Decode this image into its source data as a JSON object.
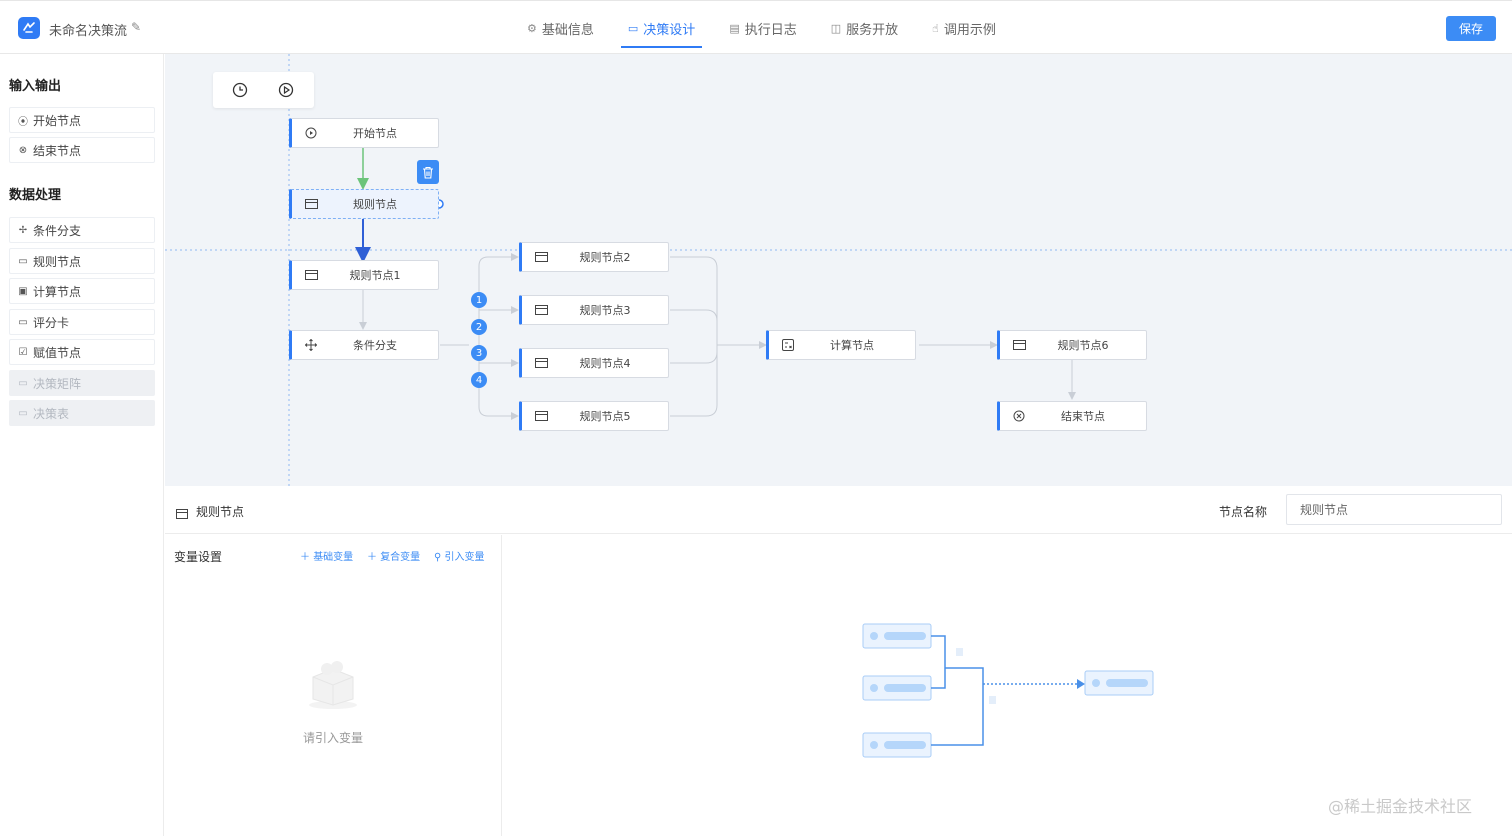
{
  "app": {
    "title": "未命名决策流"
  },
  "tabs": [
    {
      "label": "基础信息",
      "icon": "gear-icon",
      "active": false
    },
    {
      "label": "决策设计",
      "icon": "design-icon",
      "active": true
    },
    {
      "label": "执行日志",
      "icon": "document-icon",
      "active": false
    },
    {
      "label": "服务开放",
      "icon": "book-icon",
      "active": false
    },
    {
      "label": "调用示例",
      "icon": "thumb-icon",
      "active": false
    }
  ],
  "toolbar": {
    "save_label": "保存"
  },
  "sidebar": {
    "section1": "输入输出",
    "section2": "数据处理",
    "items": [
      {
        "label": "开始节点",
        "icon": "play-circle-icon",
        "disabled": false
      },
      {
        "label": "结束节点",
        "icon": "close-circle-icon",
        "disabled": false
      },
      {
        "label": "条件分支",
        "icon": "move-icon",
        "disabled": false
      },
      {
        "label": "规则节点",
        "icon": "card-icon",
        "disabled": false
      },
      {
        "label": "计算节点",
        "icon": "calculator-icon",
        "disabled": false
      },
      {
        "label": "评分卡",
        "icon": "card-icon",
        "disabled": false
      },
      {
        "label": "赋值节点",
        "icon": "edit-square-icon",
        "disabled": false
      },
      {
        "label": "决策矩阵",
        "icon": "card-icon",
        "disabled": true
      },
      {
        "label": "决策表",
        "icon": "card-icon",
        "disabled": true
      }
    ]
  },
  "flow": {
    "nodes": {
      "start": "开始节点",
      "rule": "规则节点",
      "rule1": "规则节点1",
      "branch": "条件分支",
      "rule2": "规则节点2",
      "rule3": "规则节点3",
      "rule4": "规则节点4",
      "rule5": "规则节点5",
      "calc": "计算节点",
      "rule6": "规则节点6",
      "end": "结束节点"
    },
    "badges": [
      "1",
      "2",
      "3",
      "4"
    ]
  },
  "panel": {
    "title": "规则节点",
    "node_name_label": "节点名称",
    "node_name_value": "规则节点",
    "var_title": "变量设置",
    "links": [
      "基础变量",
      "复合变量",
      "引入变量"
    ],
    "empty_text": "请引入变量"
  },
  "watermark": "@稀土掘金技术社区",
  "colors": {
    "accent": "#2f7bf5",
    "canvas_bg": "#f1f4f8",
    "edge_active": "#2f5fd6",
    "edge_start": "#6cc47a"
  }
}
